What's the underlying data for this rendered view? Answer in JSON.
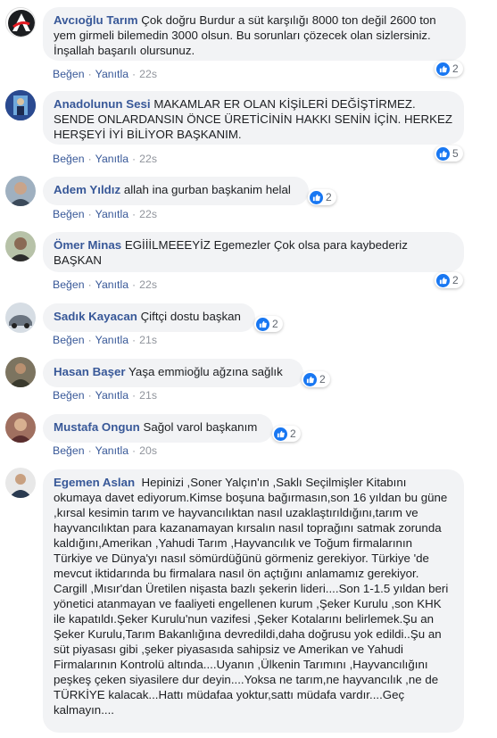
{
  "actions": {
    "like": "Beğen",
    "reply": "Yanıtla",
    "separator": "·"
  },
  "comments": [
    {
      "author": "Avcıoğlu Tarım",
      "text": "Çok doğru Burdur a süt karşılığı 8000 ton değil 2600 ton yem girmeli bilemedin 3000 olsun. Bu sorunları çözecek olan sizlersiniz. İnşallah başarılı olursunuz.",
      "time": "22s",
      "likes": "2",
      "avatar": "brand-logo",
      "color": "#1c1e21"
    },
    {
      "author": "Anadolunun Sesi",
      "text": "MAKAMLAR ER OLAN KİŞİLERİ DEĞİŞTİRMEZ. SENDE ONLARDANSIN ÖNCE ÜRETİCİNİN HAKKI SENİN İÇİN. HERKEZ HERŞEYİ İYİ BİLİYOR BAŞKANIM.",
      "time": "22s",
      "likes": "5",
      "avatar": "profile-photo",
      "color": "#1f3a7a"
    },
    {
      "author": "Adem Yıldız",
      "text": "allah ina gurban başkanim helal",
      "time": "22s",
      "likes": "2",
      "avatar": "profile-photo",
      "color": "#6b7b8c"
    },
    {
      "author": "Ömer Minas",
      "text": "EGİİİLMEEEYİZ Egemezler Çok olsa para kaybederiz BAŞKAN",
      "time": "22s",
      "likes": "2",
      "avatar": "profile-photo",
      "color": "#4a5a3a"
    },
    {
      "author": "Sadık Kayacan",
      "text": "Çiftçi dostu başkan",
      "time": "21s",
      "likes": "2",
      "avatar": "profile-photo",
      "color": "#8a9aaa"
    },
    {
      "author": "Hasan Başer",
      "text": "Yaşa emmioğlu ağzına sağlık",
      "time": "21s",
      "likes": "2",
      "avatar": "profile-photo",
      "color": "#5a5a4a"
    },
    {
      "author": "Mustafa Ongun",
      "text": "Sağol varol başkanım",
      "time": "20s",
      "likes": "2",
      "avatar": "profile-photo",
      "color": "#7a5a4a"
    },
    {
      "author": "Egemen Aslan",
      "text": "Hepinizi ,Soner Yalçın'ın ,Saklı Seçilmişler Kitabını okumaya davet ediyorum.Kimse boşuna bağırmasın,son 16 yıldan bu güne ,kırsal kesimin tarım ve hayvancılıktan nasıl uzaklaştırıldığını,tarım ve hayvancılıktan para kazanamayan kırsalın nasıl toprağını satmak zorunda kaldığını,Amerikan ,Yahudi Tarım ,Hayvancılık ve Toğum firmalarının Türkiye ve Dünya'yı nasıl sömürdüğünü görmeniz gerekiyor. Türkiye 'de mevcut iktidarında bu firmalara nasıl ön açtığını anlamamız gerekiyor. Cargill ,Mısır'dan Üretilen nişasta bazlı şekerin lideri....Son 1-1.5 yıldan beri yönetici atanmayan ve faaliyeti engellenen kurum ,Şeker Kurulu ,son KHK ile kapatıldı.Şeker Kurulu'nun vazifesi ,Şeker Kotalarını belirlemek.Şu an Şeker Kurulu,Tarım Bakanlığına devredildi,daha doğrusu yok edildi..Şu an süt piyasası gibi ,şeker piyasasıda sahipsiz ve Amerikan ve Yahudi Firmalarının Kontrolü altında....Uyanın ,Ülkenin Tarımını ,Hayvancılığını peşkeş çeken siyasilere dur deyin....Yoksa ne tarım,ne hayvancılık ,ne de TÜRKİYE kalacak...Hattı müdafaa yoktur,sattı müdafa vardır....Geç kalmayın....",
      "avatar": "profile-photo",
      "color": "#3a4a5a"
    }
  ]
}
